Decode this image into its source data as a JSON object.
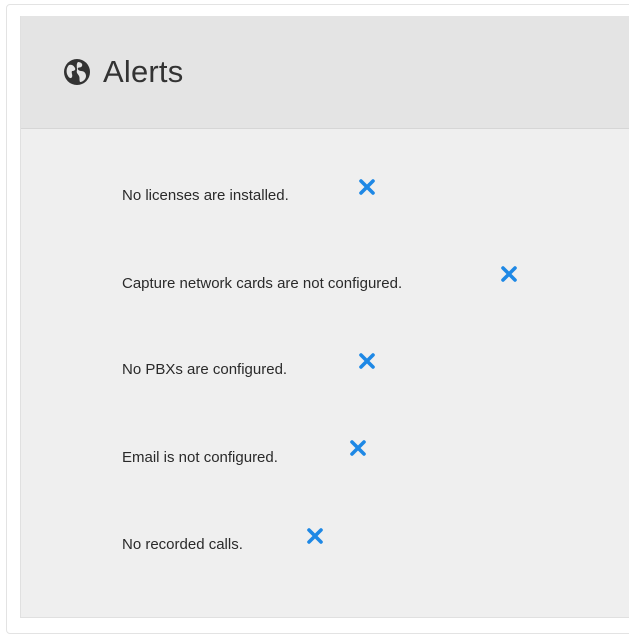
{
  "panel": {
    "title": "Alerts",
    "icon": "globe-icon"
  },
  "alerts": [
    {
      "text": "No licenses are installed.",
      "dismiss_icon": "close-icon"
    },
    {
      "text": "Capture network cards are not configured.",
      "dismiss_icon": "close-icon"
    },
    {
      "text": "No PBXs are configured.",
      "dismiss_icon": "close-icon"
    },
    {
      "text": "Email is not configured.",
      "dismiss_icon": "close-icon"
    },
    {
      "text": "No recorded calls.",
      "dismiss_icon": "close-icon"
    }
  ],
  "colors": {
    "accent": "#1e88e5",
    "header_bg": "#e4e4e4",
    "body_bg": "#efefef",
    "text": "#2a2a2a"
  }
}
